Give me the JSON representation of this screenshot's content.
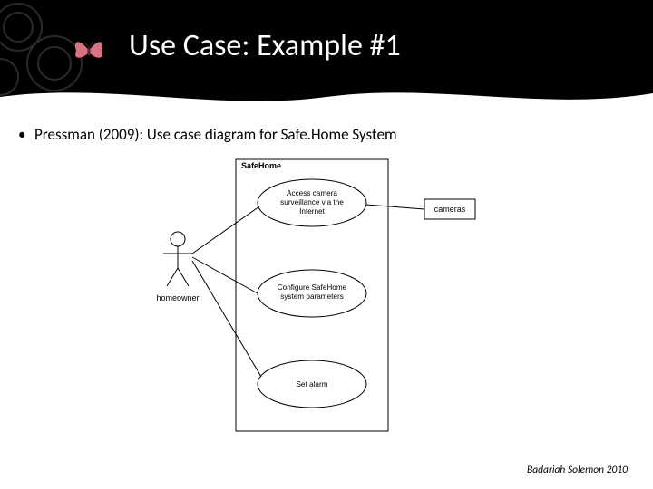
{
  "slide": {
    "title": "Use Case: Example #1"
  },
  "bullet": {
    "text": "Pressman (2009): Use case diagram for Safe.Home System"
  },
  "diagram": {
    "system_name": "SafeHome",
    "actor_left": "homeowner",
    "actor_right": "cameras",
    "usecases": {
      "uc1_line1": "Access camera",
      "uc1_line2": "surveillance via the",
      "uc1_line3": "Internet",
      "uc2_line1": "Configure SafeHome",
      "uc2_line2": "system parameters",
      "uc3_line1": "Set alarm"
    }
  },
  "footer": {
    "credit": "Badariah Solemon 2010"
  }
}
